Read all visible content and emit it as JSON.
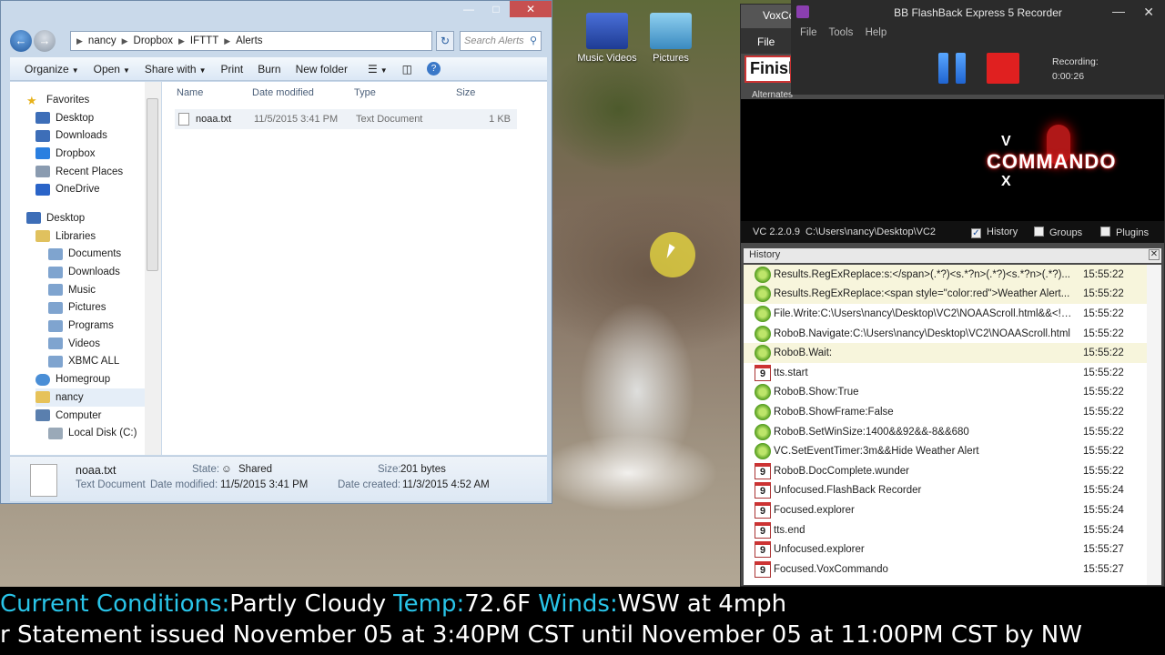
{
  "desktop": {
    "icons": [
      {
        "label": "Music Videos",
        "icon": "music-videos-folder-icon",
        "color": "#2a4fb4"
      },
      {
        "label": "Pictures",
        "icon": "pictures-folder-icon",
        "color": "#4a90c8"
      }
    ]
  },
  "explorer": {
    "address": [
      "nancy",
      "Dropbox",
      "IFTTT",
      "Alerts"
    ],
    "search_placeholder": "Search Alerts",
    "toolbar": {
      "organize": "Organize",
      "open": "Open",
      "share_with": "Share with",
      "print": "Print",
      "burn": "Burn",
      "new_folder": "New folder"
    },
    "nav": {
      "favorites_header": "Favorites",
      "favorites": [
        "Desktop",
        "Downloads",
        "Dropbox",
        "Recent Places",
        "OneDrive"
      ],
      "desktop_header": "Desktop",
      "libraries_header": "Libraries",
      "libraries": [
        "Documents",
        "Downloads",
        "Music",
        "Pictures",
        "Programs",
        "Videos",
        "XBMC ALL"
      ],
      "homegroup": "Homegroup",
      "user": "nancy",
      "computer": "Computer",
      "local_disk": "Local Disk (C:)"
    },
    "columns": {
      "name": "Name",
      "date": "Date modified",
      "type": "Type",
      "size": "Size"
    },
    "files": [
      {
        "name": "noaa.txt",
        "date": "11/5/2015 3:41 PM",
        "type": "Text Document",
        "size": "1 KB"
      }
    ],
    "details": {
      "file_name": "noaa.txt",
      "file_type": "Text Document",
      "state_label": "State:",
      "state_value": "Shared",
      "date_modified_label": "Date modified:",
      "date_modified": "11/5/2015 3:41 PM",
      "size_label": "Size:",
      "size_value": "201 bytes",
      "date_created_label": "Date created:",
      "date_created": "11/3/2015 4:52 AM"
    }
  },
  "vox": {
    "title": "VoxCo",
    "menu_file": "File",
    "finish_text": "Finish",
    "alternates_label": "Alternates",
    "logo_text": "COMMANDO",
    "logo_v": "V",
    "logo_x": "X",
    "version": "VC 2.2.0.9",
    "path": "C:\\Users\\nancy\\Desktop\\VC2",
    "history_label": "History",
    "groups_label": "Groups",
    "plugins_label": "Plugins",
    "history_header": "History",
    "history": [
      {
        "icon": "gear",
        "cmd": "Results.RegExReplace:s:</span>(.*?)<s.*?n>(.*?)<s.*?n>(.*?)...",
        "time": "15:55:22",
        "hl": true
      },
      {
        "icon": "gear",
        "cmd": "Results.RegExReplace:<span style=\"color:red\">Weather Alert...",
        "time": "15:55:22",
        "hl": true
      },
      {
        "icon": "gear",
        "cmd": "File.Write:C:\\Users\\nancy\\Desktop\\VC2\\NOAAScroll.html&&<!D...",
        "time": "15:55:22",
        "hl": false
      },
      {
        "icon": "gear",
        "cmd": "RoboB.Navigate:C:\\Users\\nancy\\Desktop\\VC2\\NOAAScroll.html",
        "time": "15:55:22",
        "hl": false
      },
      {
        "icon": "gear",
        "cmd": "RoboB.Wait:",
        "time": "15:55:22",
        "hl": true
      },
      {
        "icon": "cal",
        "cmd": "tts.start",
        "time": "15:55:22",
        "hl": false
      },
      {
        "icon": "gear",
        "cmd": "RoboB.Show:True",
        "time": "15:55:22",
        "hl": false
      },
      {
        "icon": "gear",
        "cmd": "RoboB.ShowFrame:False",
        "time": "15:55:22",
        "hl": false
      },
      {
        "icon": "gear",
        "cmd": "RoboB.SetWinSize:1400&&92&&-8&&680",
        "time": "15:55:22",
        "hl": false
      },
      {
        "icon": "gear",
        "cmd": "VC.SetEventTimer:3m&&Hide Weather Alert",
        "time": "15:55:22",
        "hl": false
      },
      {
        "icon": "cal",
        "cmd": "RoboB.DocComplete.wunder",
        "time": "15:55:22",
        "hl": false
      },
      {
        "icon": "cal",
        "cmd": "Unfocused.FlashBack Recorder",
        "time": "15:55:24",
        "hl": false
      },
      {
        "icon": "cal",
        "cmd": "Focused.explorer",
        "time": "15:55:24",
        "hl": false
      },
      {
        "icon": "cal",
        "cmd": "tts.end",
        "time": "15:55:24",
        "hl": false
      },
      {
        "icon": "cal",
        "cmd": "Unfocused.explorer",
        "time": "15:55:27",
        "hl": false
      },
      {
        "icon": "cal",
        "cmd": "Focused.VoxCommando",
        "time": "15:55:27",
        "hl": false
      }
    ],
    "cal_digit": "9"
  },
  "flashback": {
    "title": "BB FlashBack Express 5 Recorder",
    "menu": [
      "File",
      "Tools",
      "Help"
    ],
    "recording_label": "Recording:",
    "recording_time": "0:00:26"
  },
  "ticker": {
    "line1": [
      {
        "k": "Current Conditions:",
        "v": "Partly Cloudy"
      },
      {
        "k": "Temp:",
        "v": "72.6F"
      },
      {
        "k": "Winds:",
        "v": "WSW at 4mph"
      }
    ],
    "line2": "r Statement issued November 05 at 3:40PM CST until November 05 at 11:00PM CST by NW"
  },
  "colors": {
    "ticker_key": "#29c4e8",
    "record_stop": "#e02020",
    "pause_blue": "#1f64d1"
  }
}
